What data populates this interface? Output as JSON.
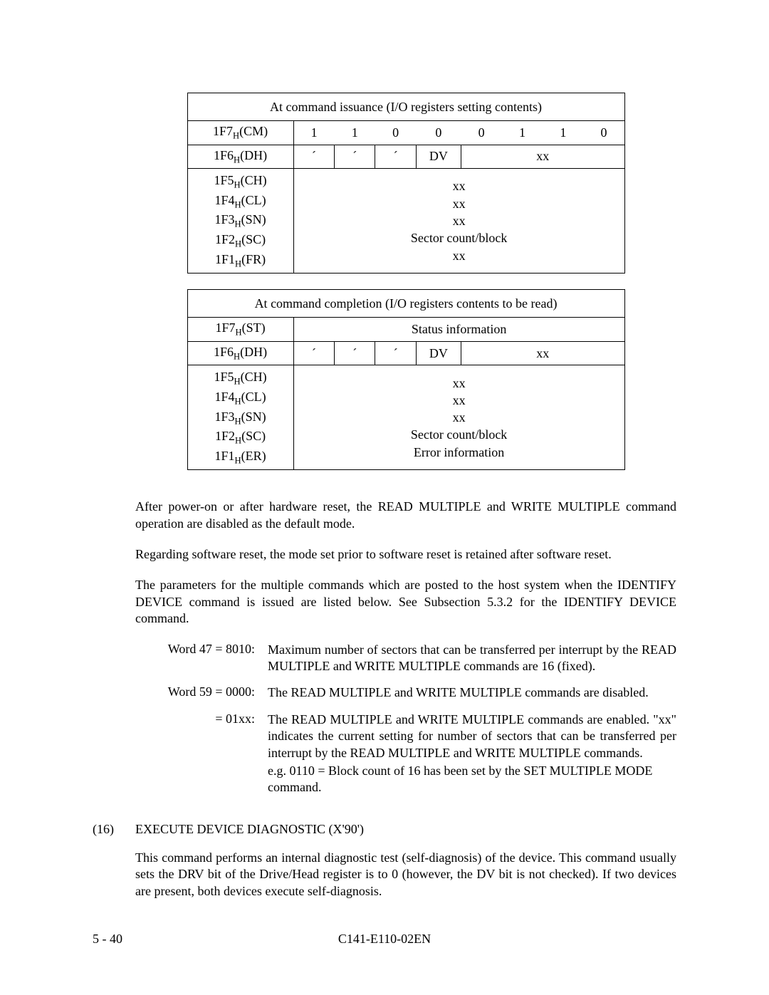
{
  "table1": {
    "title": "At command issuance (I/O registers setting contents)",
    "rows": {
      "cm": {
        "reg": "1F7",
        "suf": "H",
        "name": "(CM)",
        "bits": [
          "1",
          "1",
          "0",
          "0",
          "0",
          "1",
          "1",
          "0"
        ]
      },
      "dh": {
        "reg": "1F6",
        "suf": "H",
        "name": "(DH)",
        "cells": [
          "´",
          "´",
          "´",
          "DV"
        ],
        "right": "xx"
      },
      "multi": {
        "regs": [
          {
            "reg": "1F5",
            "suf": "H",
            "name": "(CH)"
          },
          {
            "reg": "1F4",
            "suf": "H",
            "name": "(CL)"
          },
          {
            "reg": "1F3",
            "suf": "H",
            "name": "(SN)"
          },
          {
            "reg": "1F2",
            "suf": "H",
            "name": "(SC)"
          },
          {
            "reg": "1F1",
            "suf": "H",
            "name": "(FR)"
          }
        ],
        "lines": [
          "xx",
          "xx",
          "xx",
          "Sector count/block",
          "xx"
        ]
      }
    }
  },
  "table2": {
    "title": "At command completion (I/O registers contents to be read)",
    "rows": {
      "st": {
        "reg": "1F7",
        "suf": "H",
        "name": "(ST)",
        "value": "Status information"
      },
      "dh": {
        "reg": "1F6",
        "suf": "H",
        "name": "(DH)",
        "cells": [
          "´",
          "´",
          "´",
          "DV"
        ],
        "right": "xx"
      },
      "multi": {
        "regs": [
          {
            "reg": "1F5",
            "suf": "H",
            "name": "(CH)"
          },
          {
            "reg": "1F4",
            "suf": "H",
            "name": "(CL)"
          },
          {
            "reg": "1F3",
            "suf": "H",
            "name": "(SN)"
          },
          {
            "reg": "1F2",
            "suf": "H",
            "name": "(SC)"
          },
          {
            "reg": "1F1",
            "suf": "H",
            "name": "(ER)"
          }
        ],
        "lines": [
          "xx",
          "xx",
          "xx",
          "Sector count/block",
          "Error information"
        ]
      }
    }
  },
  "paras": {
    "p1": "After power-on or after hardware reset, the READ MULTIPLE and WRITE MULTIPLE command operation are disabled as the default mode.",
    "p2": "Regarding software reset, the mode set prior to software reset is retained after software reset.",
    "p3": "The parameters for the multiple commands which are posted to the host system when the IDENTIFY DEVICE command is issued are listed below.  See Subsection 5.3.2 for the IDENTIFY DEVICE command."
  },
  "words": {
    "w47": {
      "key": "Word 47 = 8010:",
      "val": "Maximum number of sectors that can be transferred per interrupt by the READ MULTIPLE and WRITE MULTIPLE commands are 16 (fixed)."
    },
    "w59a": {
      "key": "Word 59 = 0000:",
      "val": "The READ MULTIPLE and WRITE MULTIPLE commands are disabled."
    },
    "w59b": {
      "key": "= 01xx:",
      "val": "The READ MULTIPLE and WRITE MULTIPLE commands are enabled. \"xx\" indicates the current setting for number of sectors that can be transferred per interrupt by the READ MULTIPLE and WRITE MULTIPLE commands."
    },
    "w59c": {
      "val": "e.g.  0110 = Block count of 16 has been set by the SET MULTIPLE MODE command."
    }
  },
  "section": {
    "num": "(16)",
    "title": "EXECUTE DEVICE DIAGNOSTIC (X'90')",
    "body": "This command performs an internal diagnostic test (self-diagnosis) of the device.  This command usually sets the DRV bit of the Drive/Head register is to 0 (however, the DV bit is not checked). If two devices are present, both devices execute self-diagnosis."
  },
  "footer": {
    "left": "5 - 40",
    "center": "C141-E110-02EN"
  }
}
